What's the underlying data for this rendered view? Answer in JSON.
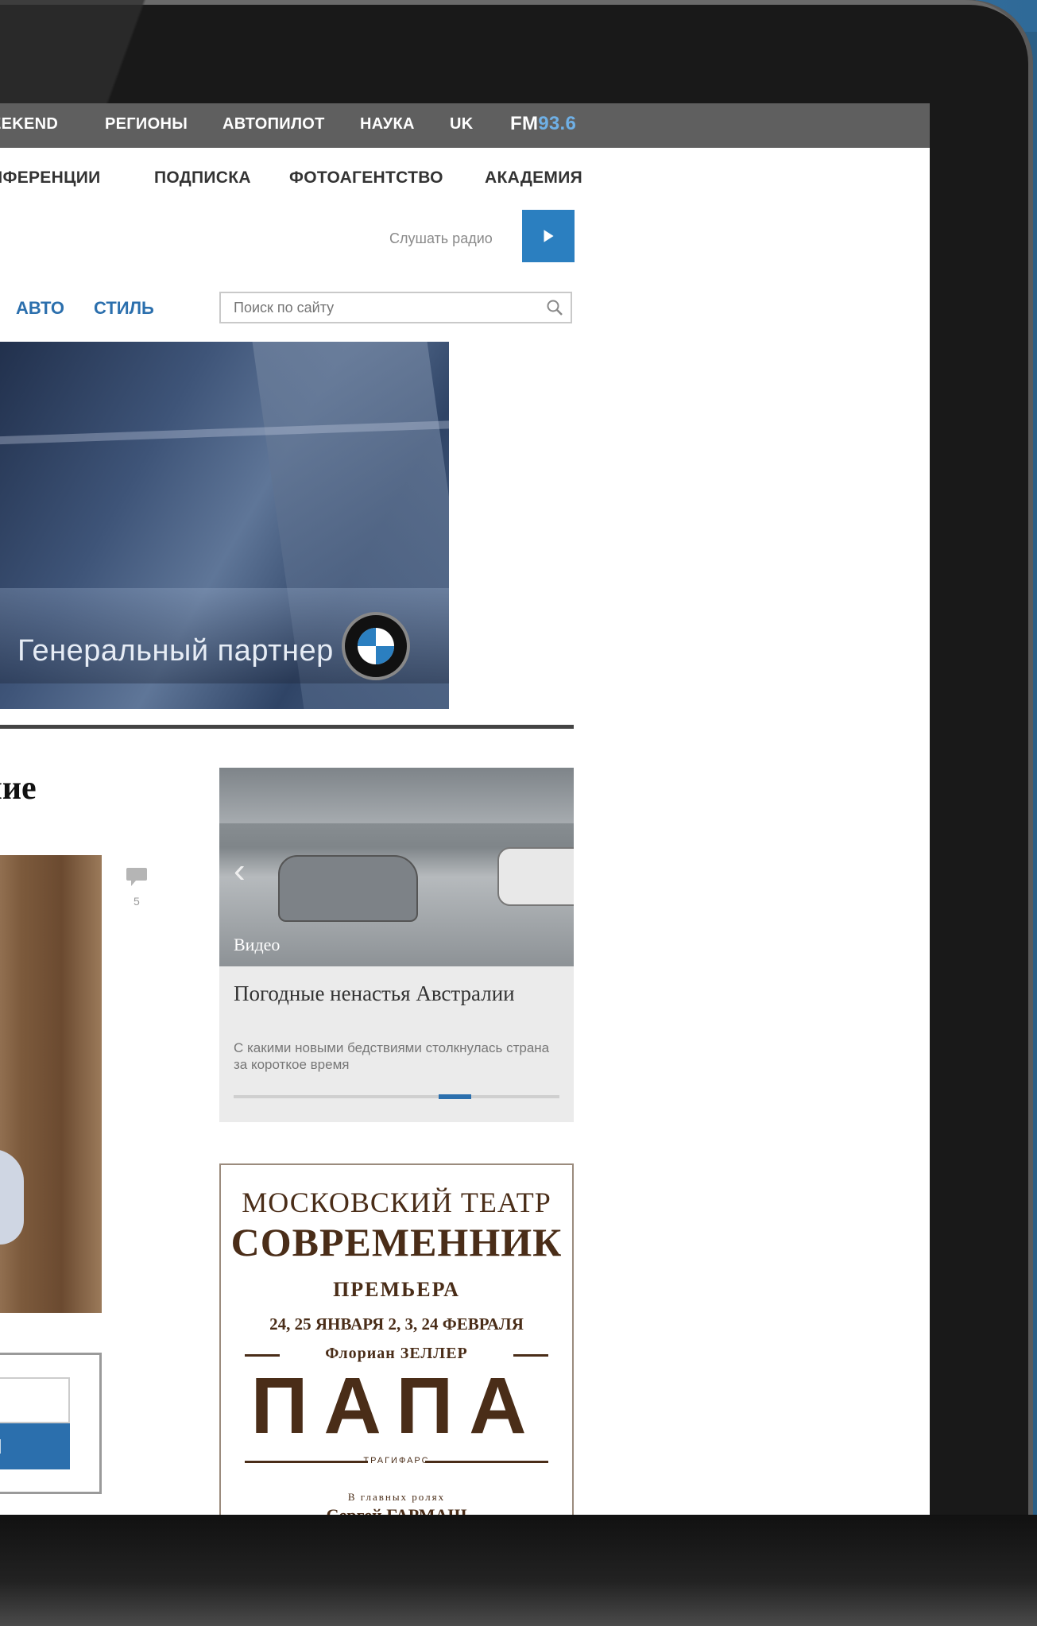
{
  "topnav": {
    "items": [
      "EEKEND",
      "РЕГИОНЫ",
      "АВТОПИЛОТ",
      "НАУКА",
      "UK"
    ],
    "fm_prefix": "FM",
    "fm_freq": "93.6"
  },
  "secnav": {
    "items": [
      "НФЕРЕНЦИИ",
      "ПОДПИСКА",
      "ФОТОАГЕНТСТВО",
      "АКАДЕМИЯ"
    ]
  },
  "radio": {
    "label": "Слушать радио"
  },
  "catnav": {
    "items": [
      "АВТО",
      "СТИЛЬ"
    ]
  },
  "search": {
    "placeholder": "Поиск по сайту"
  },
  "banner": {
    "text": "Генеральный партнер",
    "brand": "BMW"
  },
  "article": {
    "title_fragment": "ение",
    "comment_count": "5"
  },
  "subscribe": {
    "button_fragment": "СЯ"
  },
  "video_card": {
    "label": "Видео",
    "title": "Погодные ненастья Австралии",
    "description": "С какими новыми бедствиями столкнулась страна за короткое время",
    "progress_start": 0.63,
    "progress_width": 0.1
  },
  "theatre_ad": {
    "line1": "МОСКОВСКИЙ ТЕАТР",
    "line2": "СОВРЕМЕННИК",
    "line3": "ПРЕМЬЕРА",
    "dates": "24, 25 ЯНВАРЯ   2, 3, 24 ФЕВРАЛЯ",
    "author": "Флориан ЗЕЛЛЕР",
    "play": "ПАПА",
    "translator": "ТРАГИФАРС",
    "role_caption": "В главных ролях",
    "actor": "Сергей ГАРМАШ"
  },
  "colors": {
    "accent": "#2b6fad",
    "nav_bg": "#5f5f5f",
    "fm_accent": "#6fb0e6",
    "theatre_brown": "#4a2d18"
  }
}
